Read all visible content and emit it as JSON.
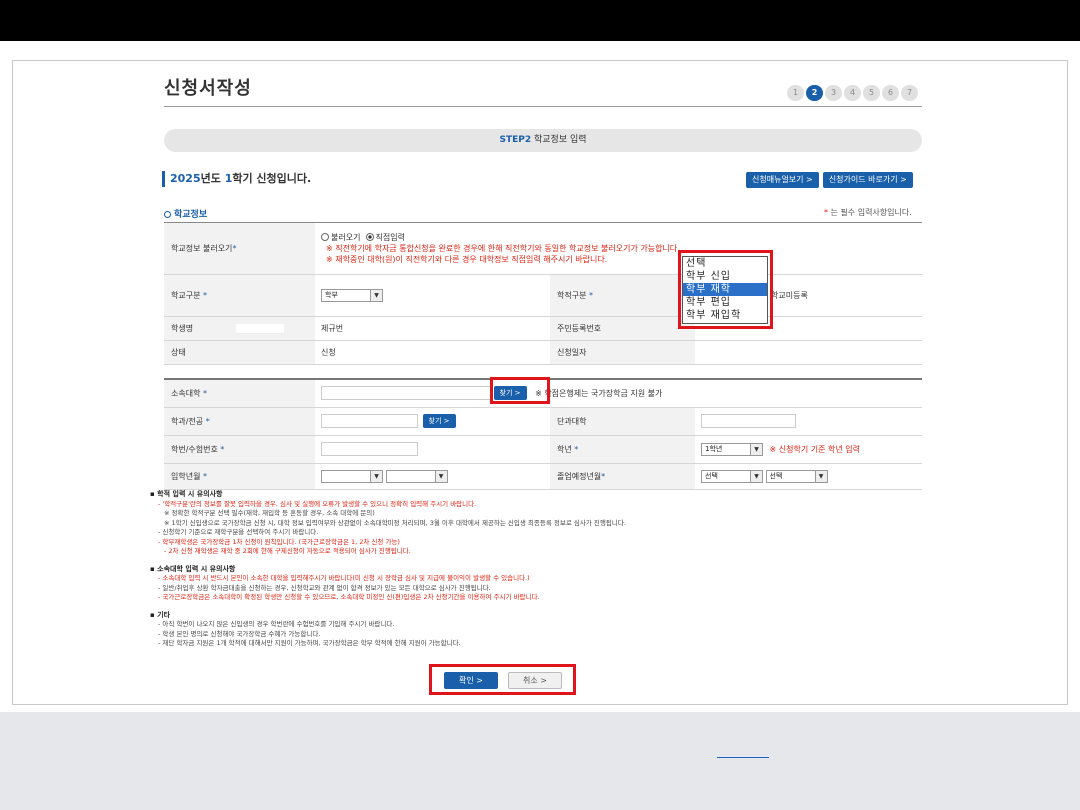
{
  "page": {
    "title": "신청서작성",
    "steps": [
      "1",
      "2",
      "3",
      "4",
      "5",
      "6",
      "7"
    ],
    "active_step": 2,
    "step_bar": {
      "step": "STEP2",
      "label": "학교정보 입력"
    },
    "semester": {
      "year": "2025",
      "year_suffix": "년도 ",
      "term": "1",
      "term_suffix": "학기 신청입니다."
    },
    "buttons": {
      "menu_view": "신청매뉴얼보기 >",
      "guide": "신청가이드 바로가기 >"
    },
    "section_title": "학교정보",
    "required_note": {
      "star": "*",
      "text": " 는 필수 입력사항입니다."
    }
  },
  "school_info": {
    "load": {
      "label": "학교정보 불러오기",
      "option1": "불러오기",
      "option2": "직접입력",
      "note1": "※ 직전학기에 학자금 통합신청을 완료한 경우에 한해 직전학기와 동일한 학교정보 불러오기가 가능합니다.",
      "note2": "※ 재학중인 대학(원)이 직전학기와 다른 경우 대학정보 직접입력 해주시기 바랍니다."
    },
    "school_type": {
      "label": "학교구분",
      "value": "학부"
    },
    "academic_type": {
      "label": "학적구분",
      "trailing": "학교미등록"
    },
    "student_name": {
      "label": "학생명"
    },
    "gender": {
      "label": "제규번",
      "value": ""
    },
    "resident_no": {
      "label": "주민등록번호"
    },
    "status": {
      "label": "상태",
      "value": "신청"
    },
    "apply_date": {
      "label": "신청일자"
    }
  },
  "dropdown_options": [
    "선택",
    "학부 신입",
    "학부 재학",
    "학부 편입",
    "학부 재입학"
  ],
  "dropdown_selected": "학부 재학",
  "university": {
    "school": {
      "label": "소속대학",
      "search": "찾기 >",
      "note": "※ 학점은행제는 국가장학금 지원 불가"
    },
    "dept": {
      "label": "학과/전공",
      "search": "찾기 >"
    },
    "college": {
      "label": "단과대학"
    },
    "student_id": {
      "label": "학번/수험번호"
    },
    "grade": {
      "label": "학년",
      "value": "1학년",
      "note": "※ 신청학기 기준 학년 입력"
    },
    "entry": {
      "label": "입학년월"
    },
    "graduation": {
      "label": "졸업예정년월",
      "year": "선택",
      "month": "선택"
    }
  },
  "notes": {
    "sec1_title": "▪ 학적 입력 시 유의사항",
    "sec1": [
      {
        "text": "- '학적구분'란의 정보를 잘못 입력하을 경우, 심사 및 실행에 오류가 발생할 수 있으니 정확히 입력해 주시기 바랍니다.",
        "red": true,
        "indent": 1
      },
      {
        "text": "※ 정확한 학적구분 선택 필수(재학, 재입학 등 혼동할 경우, 소속 대학에 문의)",
        "red": false,
        "indent": 2
      },
      {
        "text": "※ 1학기 신입생으로 국가장학금 신청 시, 대학 정보 입력여부와 상관없이 소속대학미정 처리되며, 3월 이후 대학에서 제공하는 신입생 최종등록 정보로 심사가 진행됩니다.",
        "red": false,
        "indent": 2
      },
      {
        "text": "- 신청학기 기준으로 재학구분을 선택하여 주시기 바랍니다.",
        "red": false,
        "indent": 1
      },
      {
        "text": "- 학부재학생은 국가장학금 1차 신청이 원칙입니다. (국가근로장학금은 1, 2차 신청 가능)",
        "red": true,
        "indent": 1
      },
      {
        "text": "- 2차 신청 재학생은 재학 중 2회에 한해 구제신청이 자동으로 적용되어 심사가 진행됩니다.",
        "red": true,
        "indent": 2
      }
    ],
    "sec2_title": "▪ 소속대학 입력 시 유의사항",
    "sec2": [
      {
        "text": "- 소속대학 입력 시 반드시 본인이 소속한 대학을 입력해주시기 바랍니다(미 신청 시 장학금 심사 및 지급에 불이익이 발생할 수 있습니다.)",
        "red": true,
        "indent": 1
      },
      {
        "text": "- 일반/취업후 상환 학자금대출을 신청하는 경우, 신청학교와 관계 없이 합격 정보가 있는 모든 대학으로 심사가 진행됩니다.",
        "red": false,
        "indent": 1
      },
      {
        "text": "- 국가근로장학금은 소속대학이 확정된 학생만 신청할 수 있으므로, 소속대학 미정인 신(편)입생은 2차 신청기간을 이용하여 주시기 바랍니다.",
        "red": true,
        "indent": 1
      }
    ],
    "sec3_title": "▪ 기타",
    "sec3": [
      {
        "text": "- 아직 학번이 나오지 않은 신입생의 경우 학번란에 수험번호를 기입해 주시기 바랍니다.",
        "red": false,
        "indent": 1
      },
      {
        "text": "- 학생 본인 명의로 신청해야 국가장학금 수혜가 가능합니다.",
        "red": false,
        "indent": 1
      },
      {
        "text": "- 재단 학자금 지원은 1개 학적에 대해서만 지원이 가능하며, 국가장학금은 학부 학적에 한해 지원이 가능합니다.",
        "red": false,
        "indent": 1
      }
    ]
  },
  "actions": {
    "confirm": "확인 >",
    "cancel": "취소 >"
  },
  "colors": {
    "accent": "#1a5fa9",
    "highlight_box": "#e0141b",
    "warning_text": "#dd2211"
  }
}
